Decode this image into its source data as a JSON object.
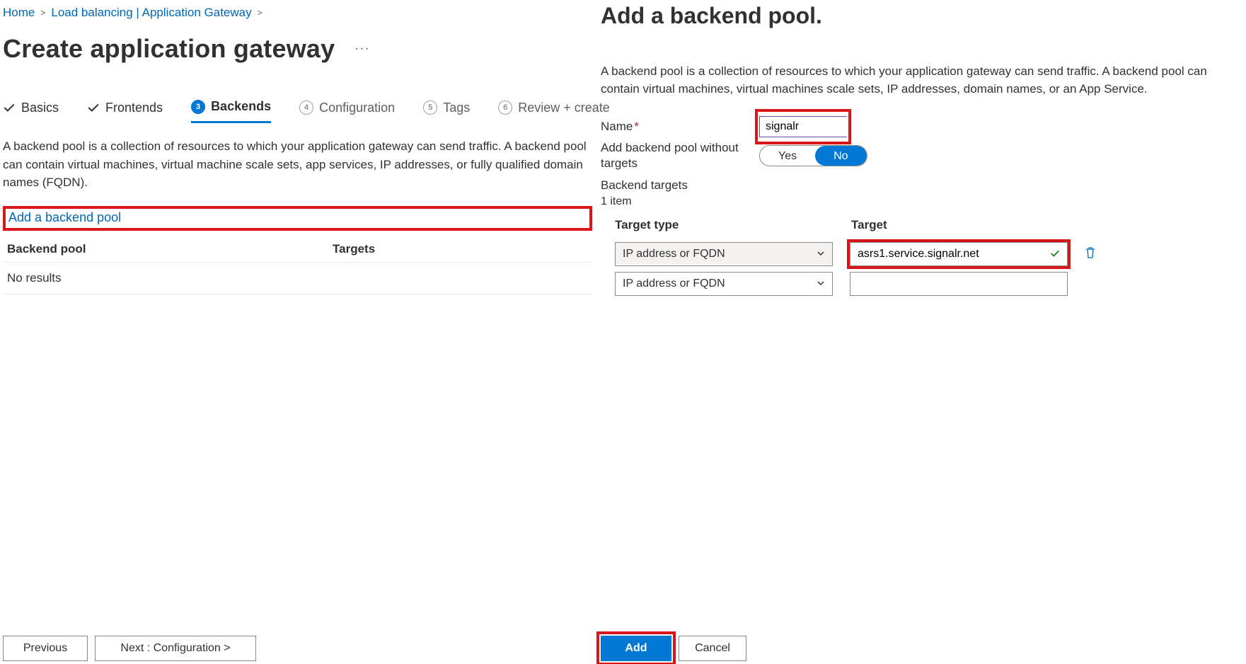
{
  "breadcrumb": {
    "home": "Home",
    "lb": "Load balancing | Application Gateway"
  },
  "page": {
    "title": "Create application gateway"
  },
  "wizard": {
    "basics": "Basics",
    "frontends": "Frontends",
    "backends": "Backends",
    "configuration": "Configuration",
    "tags": "Tags",
    "review": "Review + create"
  },
  "backendsTab": {
    "description": "A backend pool is a collection of resources to which your application gateway can send traffic. A backend pool can contain virtual machines, virtual machine scale sets, app services, IP addresses, or fully qualified domain names (FQDN).",
    "addLink": "Add a backend pool",
    "colPool": "Backend pool",
    "colTargets": "Targets",
    "noResults": "No results"
  },
  "footer": {
    "previous": "Previous",
    "next": "Next : Configuration >"
  },
  "panel": {
    "title": "Add a backend pool.",
    "desc": "A backend pool is a collection of resources to which your application gateway can send traffic. A backend pool can contain virtual machines, virtual machines scale sets, IP addresses, domain names, or an App Service.",
    "nameLabel": "Name",
    "nameValue": "signalr",
    "noTargetsLabel": "Add backend pool without targets",
    "yes": "Yes",
    "no": "No",
    "targetsHead": "Backend targets",
    "itemsCount": "1 item",
    "ttHeader": "Target type",
    "tvHeader": "Target",
    "row1Type": "IP address or FQDN",
    "row1Value": "asrs1.service.signalr.net",
    "row2Type": "IP address or FQDN",
    "add": "Add",
    "cancel": "Cancel"
  }
}
